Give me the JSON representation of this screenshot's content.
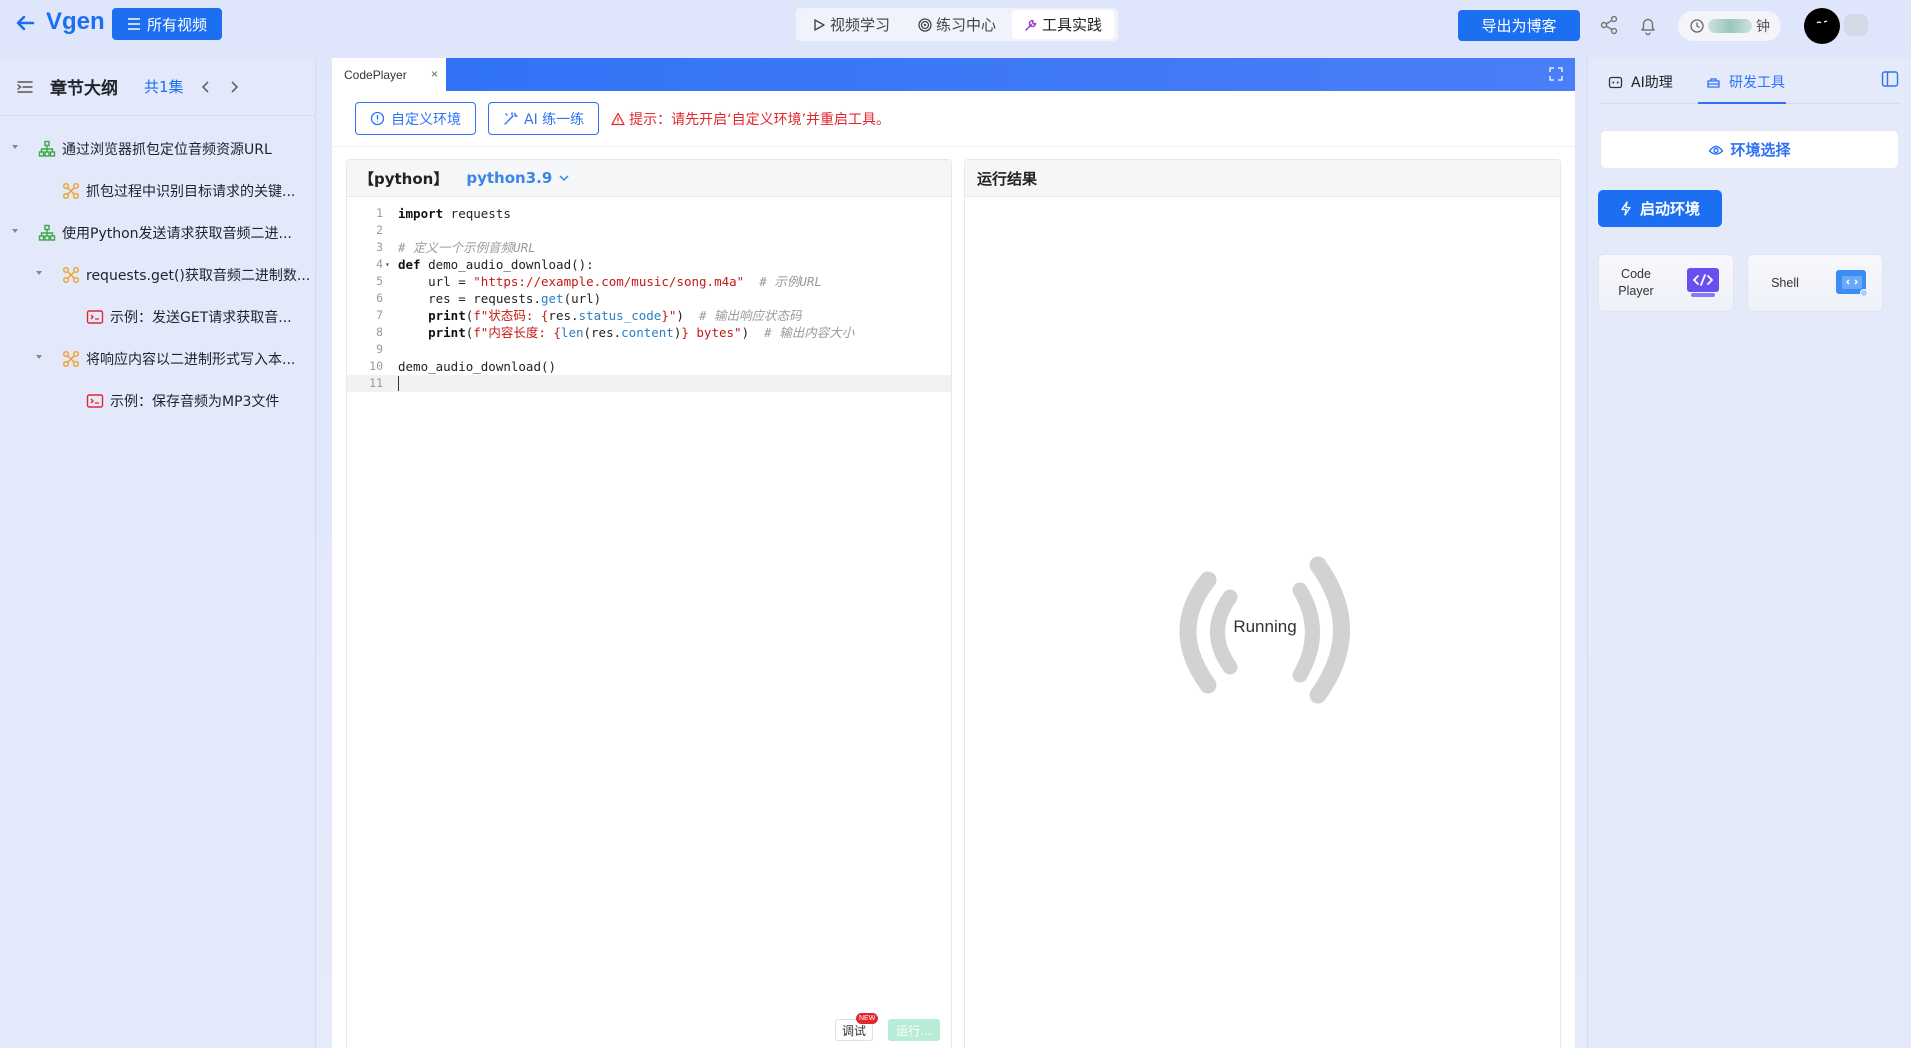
{
  "header": {
    "logo": "Vgen",
    "all_videos_label": "所有视频",
    "mode_tabs": [
      {
        "label": "视频学习",
        "icon": "play-icon",
        "active": false
      },
      {
        "label": "练习中心",
        "icon": "target-icon",
        "active": false
      },
      {
        "label": "工具实践",
        "icon": "wrench-icon",
        "active": true
      }
    ],
    "export_label": "导出为博客",
    "timer_suffix": "钟"
  },
  "sidebar": {
    "title": "章节大纲",
    "episode_count": "共1集",
    "items": [
      {
        "label": "通过浏览器抓包定位音频资源URL",
        "level": 0,
        "icon": "tree-icon",
        "expanded": true
      },
      {
        "label": "抓包过程中识别目标请求的关键...",
        "level": 1,
        "icon": "nodes-icon",
        "expanded": false
      },
      {
        "label": "使用Python发送请求获取音频二进...",
        "level": 0,
        "icon": "tree-icon",
        "expanded": true
      },
      {
        "label": "requests.get()获取音频二进制数...",
        "level": 1,
        "icon": "nodes-icon",
        "expanded": true
      },
      {
        "label": "示例：发送GET请求获取音...",
        "level": 2,
        "icon": "code-example-icon",
        "expanded": false
      },
      {
        "label": "将响应内容以二进制形式写入本...",
        "level": 1,
        "icon": "nodes-icon",
        "expanded": true
      },
      {
        "label": "示例：保存音频为MP3文件",
        "level": 2,
        "icon": "code-example-icon",
        "expanded": false
      }
    ]
  },
  "main": {
    "tab_label": "CodePlayer",
    "tab_close": "×",
    "custom_env_label": "自定义环境",
    "ai_practice_label": "AI 练一练",
    "tip": "提示：请先开启‘自定义环境’并重启工具。",
    "editor": {
      "language": "【python】",
      "version": "python3.9",
      "line_numbers": [
        "1",
        "2",
        "3",
        "4",
        "5",
        "6",
        "7",
        "8",
        "9",
        "10",
        "11"
      ],
      "debug_label": "调试",
      "new_badge": "NEW",
      "run_label": "运行..."
    },
    "result": {
      "title": "运行结果",
      "status": "Running"
    }
  },
  "right_panel": {
    "tabs": [
      {
        "label": "AI助理",
        "icon": "ai-assistant-icon",
        "active": false
      },
      {
        "label": "研发工具",
        "icon": "toolbox-icon",
        "active": true
      }
    ],
    "env_select_label": "环境选择",
    "start_env_label": "启动环境",
    "tools": [
      {
        "name_line1": "Code",
        "name_line2": "Player",
        "icon": "code-player-icon"
      },
      {
        "name_line1": "Shell",
        "name_line2": "",
        "icon": "shell-icon"
      }
    ]
  },
  "colors": {
    "accent": "#1d6ff2",
    "warning": "#e4262d",
    "run_disabled": "#b8ecd6"
  }
}
